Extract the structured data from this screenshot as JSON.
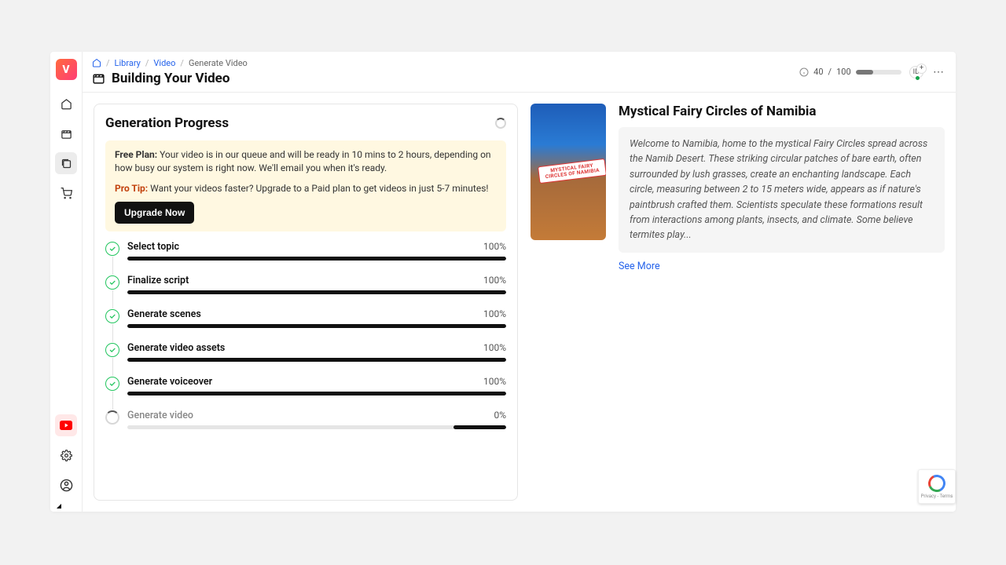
{
  "logo_letter": "V",
  "breadcrumb": {
    "home_icon": "home-icon",
    "library": "Library",
    "video": "Video",
    "current": "Generate Video"
  },
  "page_title": "Building Your Video",
  "credits": {
    "used": "40",
    "sep": " / ",
    "total": "100",
    "fill_pct": 38
  },
  "id_badge": "ID",
  "progress_card": {
    "title": "Generation Progress",
    "notice": {
      "plan_label": "Free Plan:",
      "plan_text": " Your video is in our queue and will be ready in 10 mins to 2 hours, depending on how busy our system is right now. We'll email you when it's ready.",
      "tip_label": "Pro Tip:",
      "tip_text": " Want your videos faster? Upgrade to a Paid plan to get videos in just 5-7 minutes!",
      "upgrade_btn": "Upgrade Now"
    },
    "steps": [
      {
        "label": "Select topic",
        "pct": "100%",
        "fill": 100,
        "done": true
      },
      {
        "label": "Finalize script",
        "pct": "100%",
        "fill": 100,
        "done": true
      },
      {
        "label": "Generate scenes",
        "pct": "100%",
        "fill": 100,
        "done": true
      },
      {
        "label": "Generate video assets",
        "pct": "100%",
        "fill": 100,
        "done": true
      },
      {
        "label": "Generate voiceover",
        "pct": "100%",
        "fill": 100,
        "done": true
      },
      {
        "label": "Generate video",
        "pct": "0%",
        "fill": 0,
        "done": false
      }
    ]
  },
  "thumbnail_caption": "MYSTICAL FAIRY CIRCLES OF NAMIBIA",
  "video_title": "Mystical Fairy Circles of Namibia",
  "description": "Welcome to Namibia, home to the mystical Fairy Circles spread across the Namib Desert. These striking circular patches of bare earth, often surrounded by lush grasses, create an enchanting landscape. Each circle, measuring between 2 to 15 meters wide, appears as if nature's paintbrush crafted them. Scientists speculate these formations result from interactions among plants, insects, and climate. Some believe termites play...",
  "see_more": "See More",
  "recaptcha_text": "Privacy - Terms"
}
